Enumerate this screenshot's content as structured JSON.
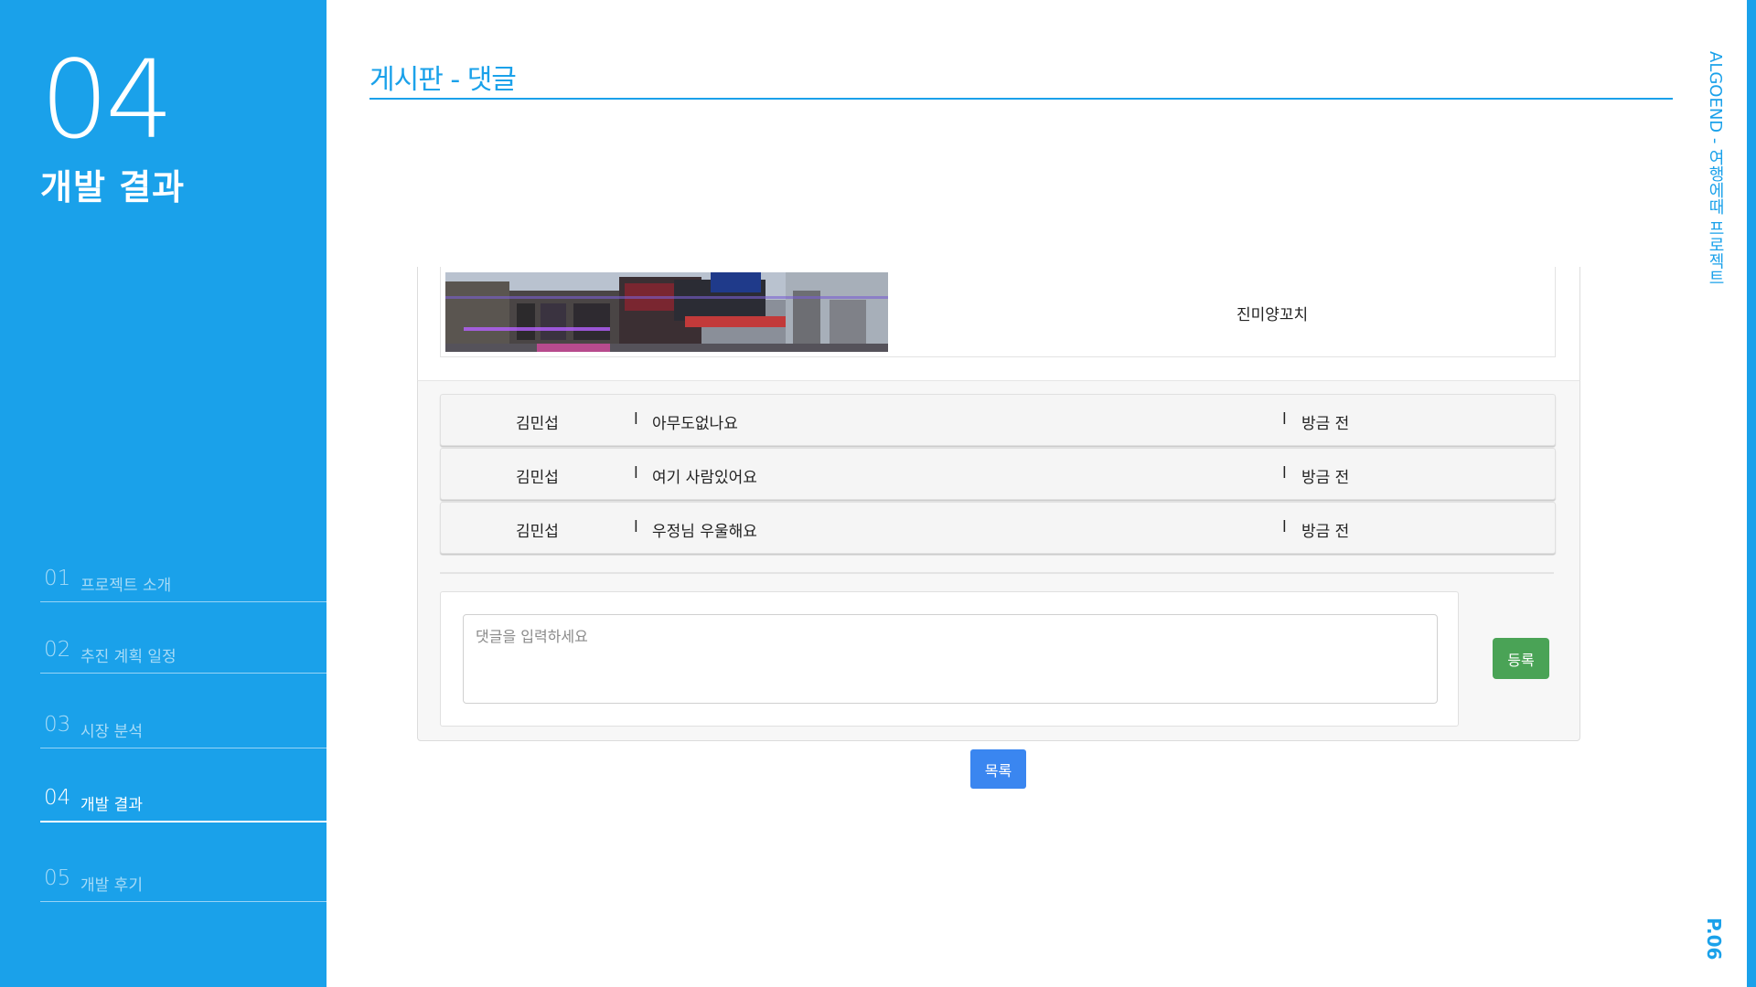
{
  "sidebar": {
    "section_number": "04",
    "section_title": "개발 결과",
    "toc": [
      {
        "num": "01",
        "label": "프로젝트 소개",
        "active": false
      },
      {
        "num": "02",
        "label": "추진 계획 일정",
        "active": false
      },
      {
        "num": "03",
        "label": "시장 분석",
        "active": false
      },
      {
        "num": "04",
        "label": "개발 결과",
        "active": true
      },
      {
        "num": "05",
        "label": "개발 후기",
        "active": false
      }
    ]
  },
  "header": {
    "title": "게시판 - 댓글",
    "side_caption": "ALGOEND - 여행에때 프로젝트",
    "page_number": "P.06"
  },
  "post": {
    "image_icon": "street-photo",
    "name": "진미양꼬치"
  },
  "comments": [
    {
      "author": "김민섭",
      "separator": "l",
      "text": "아무도없나요",
      "time": "방금 전"
    },
    {
      "author": "김민섭",
      "separator": "l",
      "text": "여기 사람있어요",
      "time": "방금 전"
    },
    {
      "author": "김민섭",
      "separator": "l",
      "text": "우정님 우울해요",
      "time": "방금 전"
    }
  ],
  "comment_form": {
    "placeholder": "댓글을 입력하세요",
    "submit_label": "등록"
  },
  "list_button_label": "목록",
  "colors": {
    "brand_blue": "#1aa1ea",
    "submit_green": "#4aa356",
    "list_blue": "#3a86f0"
  }
}
